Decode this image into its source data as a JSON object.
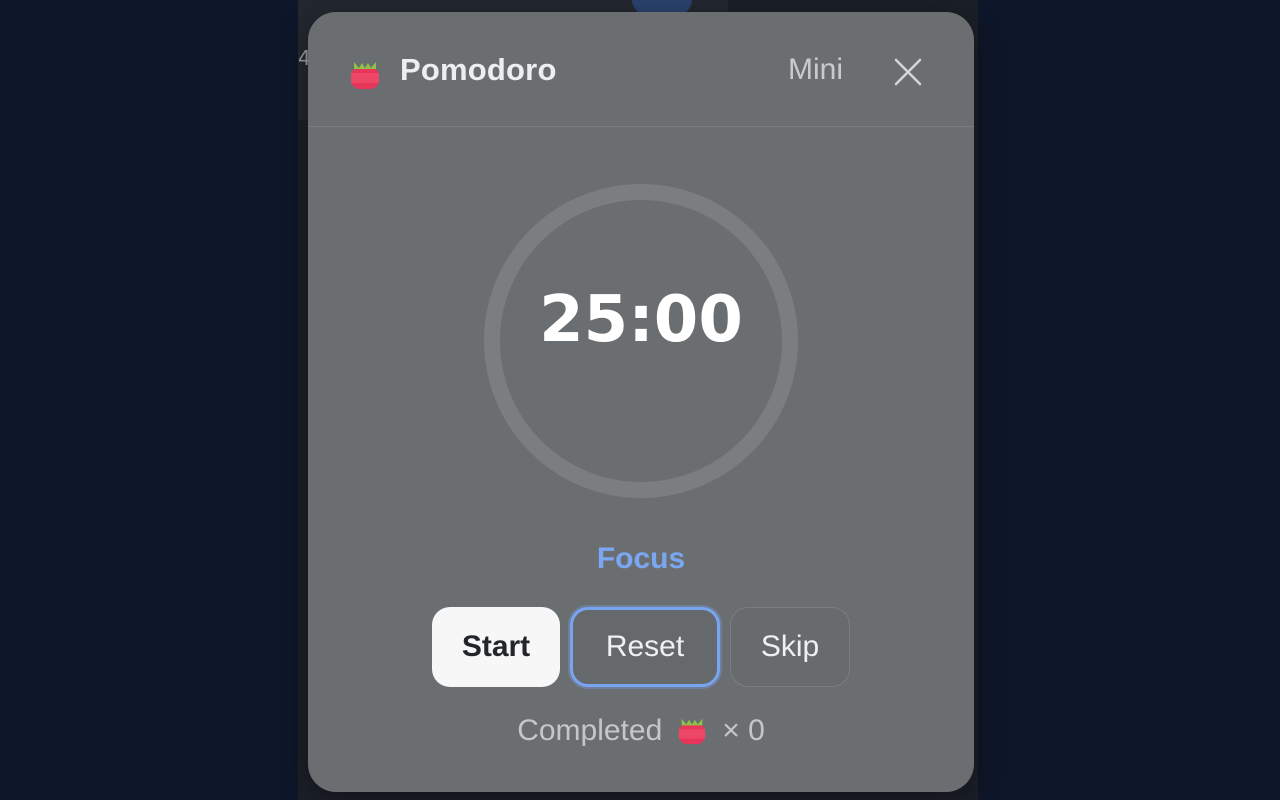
{
  "background": {
    "glyph": "4"
  },
  "header": {
    "title": "Pomodoro",
    "icon": "tomato-icon",
    "mini_label": "Mini",
    "close_icon": "close-icon"
  },
  "timer": {
    "time": "25:00",
    "mode": "Focus",
    "progress": 0
  },
  "controls": {
    "start_label": "Start",
    "reset_label": "Reset",
    "skip_label": "Skip"
  },
  "stats": {
    "completed_label": "Completed",
    "icon": "tomato-icon",
    "count_text": "× 0"
  },
  "colors": {
    "panel": "#6b6e71",
    "accent": "#7aa7f2",
    "tomato_red": "#e8365a",
    "tomato_leaf": "#8bc34a"
  }
}
